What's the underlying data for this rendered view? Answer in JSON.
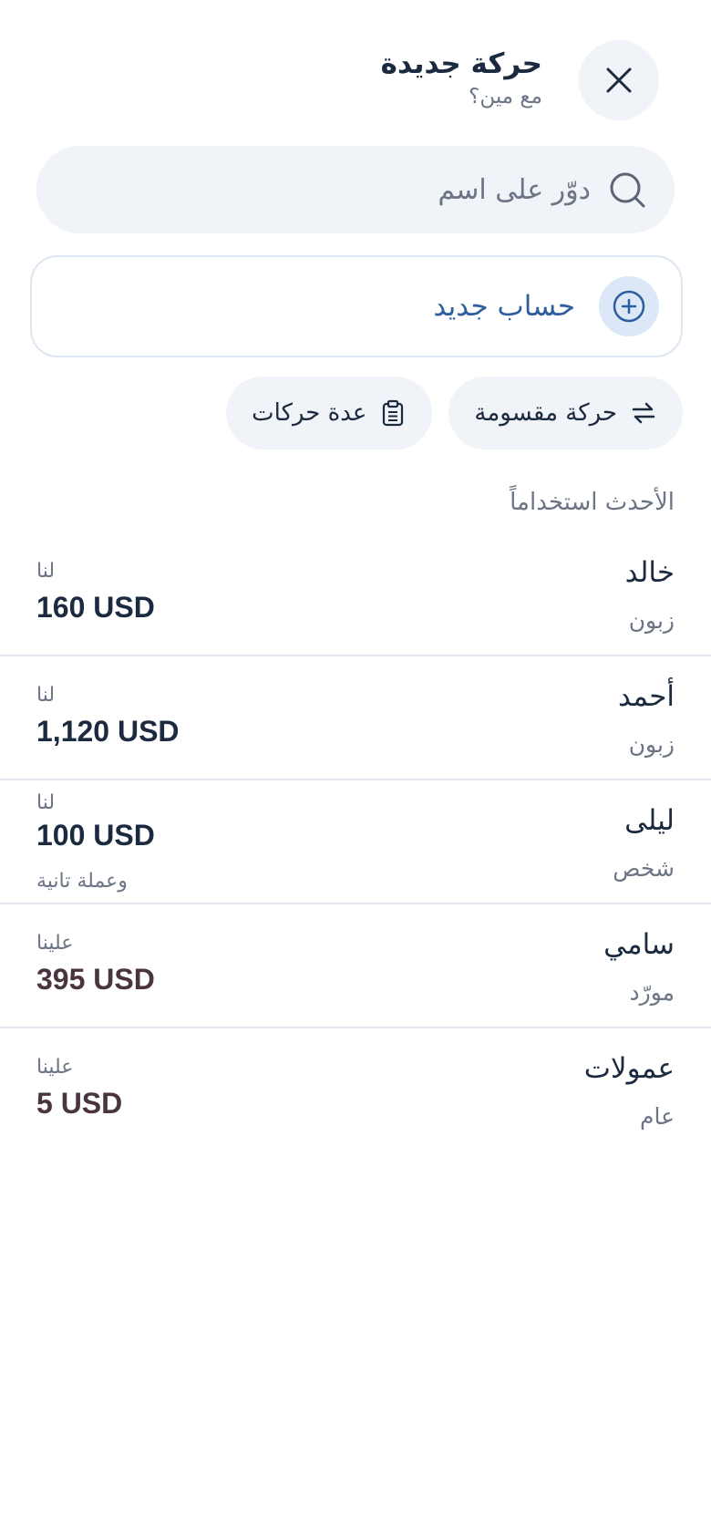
{
  "header": {
    "title": "حركة جديدة",
    "subtitle": "مع مين؟"
  },
  "search": {
    "placeholder": "دوّر على اسم"
  },
  "new_account": {
    "label": "حساب جديد"
  },
  "chips": [
    {
      "label": "حركة مقسومة",
      "icon": "split-arrows-icon"
    },
    {
      "label": "عدة حركات",
      "icon": "clipboard-list-icon"
    }
  ],
  "section_label": "الأحدث استخداماً",
  "contacts": [
    {
      "name": "خالد",
      "type": "زبون",
      "direction": "لنا",
      "amount": "160 USD"
    },
    {
      "name": "أحمد",
      "type": "زبون",
      "direction": "لنا",
      "amount": "1,120 USD"
    },
    {
      "name": "ليلى",
      "type": "شخص",
      "direction": "لنا",
      "amount": "100 USD",
      "extra": "وعملة تانية"
    },
    {
      "name": "سامي",
      "type": "مورّد",
      "direction": "علينا",
      "amount": "395 USD"
    },
    {
      "name": "عمولات",
      "type": "عام",
      "direction": "علينا",
      "amount": "5 USD"
    }
  ],
  "colors": {
    "accent": "#2f5e9e",
    "surface": "#f0f3f7",
    "text": "#1b2a3f",
    "muted": "#6b7585",
    "debt": "#4a3440"
  }
}
